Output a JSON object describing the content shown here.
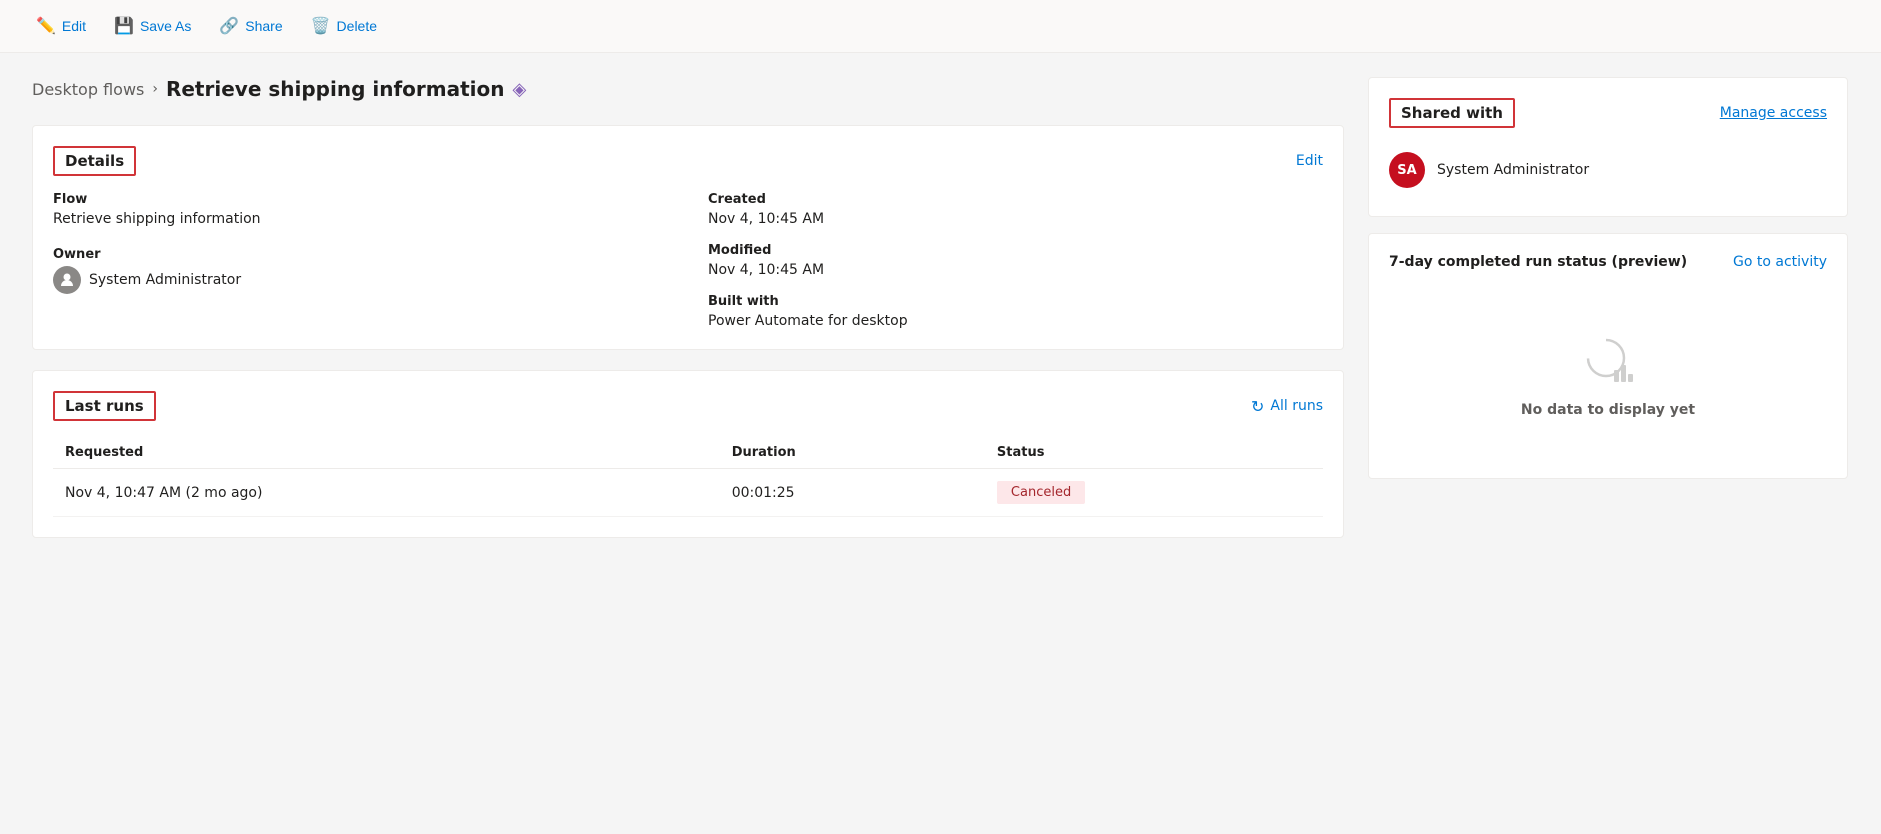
{
  "toolbar": {
    "edit_label": "Edit",
    "save_as_label": "Save As",
    "share_label": "Share",
    "delete_label": "Delete"
  },
  "breadcrumb": {
    "parent": "Desktop flows",
    "current": "Retrieve shipping information"
  },
  "details_card": {
    "title": "Details",
    "edit_link": "Edit",
    "flow_label": "Flow",
    "flow_value": "Retrieve shipping information",
    "owner_label": "Owner",
    "owner_value": "System Administrator",
    "created_label": "Created",
    "created_value": "Nov 4, 10:45 AM",
    "modified_label": "Modified",
    "modified_value": "Nov 4, 10:45 AM",
    "built_with_label": "Built with",
    "built_with_value": "Power Automate for desktop"
  },
  "last_runs_card": {
    "title": "Last runs",
    "all_runs_label": "All runs",
    "table_headers": [
      "Requested",
      "Duration",
      "Status"
    ],
    "rows": [
      {
        "requested": "Nov 4, 10:47 AM (2 mo ago)",
        "duration": "00:01:25",
        "status": "Canceled"
      }
    ]
  },
  "shared_with_card": {
    "title": "Shared with",
    "manage_access_label": "Manage access",
    "users": [
      {
        "initials": "SA",
        "name": "System Administrator"
      }
    ]
  },
  "run_status_card": {
    "title": "7-day completed run status (preview)",
    "go_to_activity_label": "Go to activity",
    "no_data_text": "No data to display yet"
  }
}
